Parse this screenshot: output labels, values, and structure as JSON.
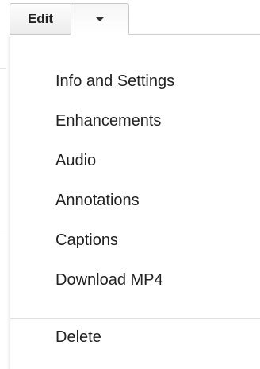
{
  "toolbar": {
    "edit_label": "Edit",
    "dropdown_icon": "caret-down-icon"
  },
  "menu": {
    "items": [
      {
        "label": "Info and Settings"
      },
      {
        "label": "Enhancements"
      },
      {
        "label": "Audio"
      },
      {
        "label": "Annotations"
      },
      {
        "label": "Captions"
      },
      {
        "label": "Download MP4"
      }
    ],
    "delete_label": "Delete"
  }
}
